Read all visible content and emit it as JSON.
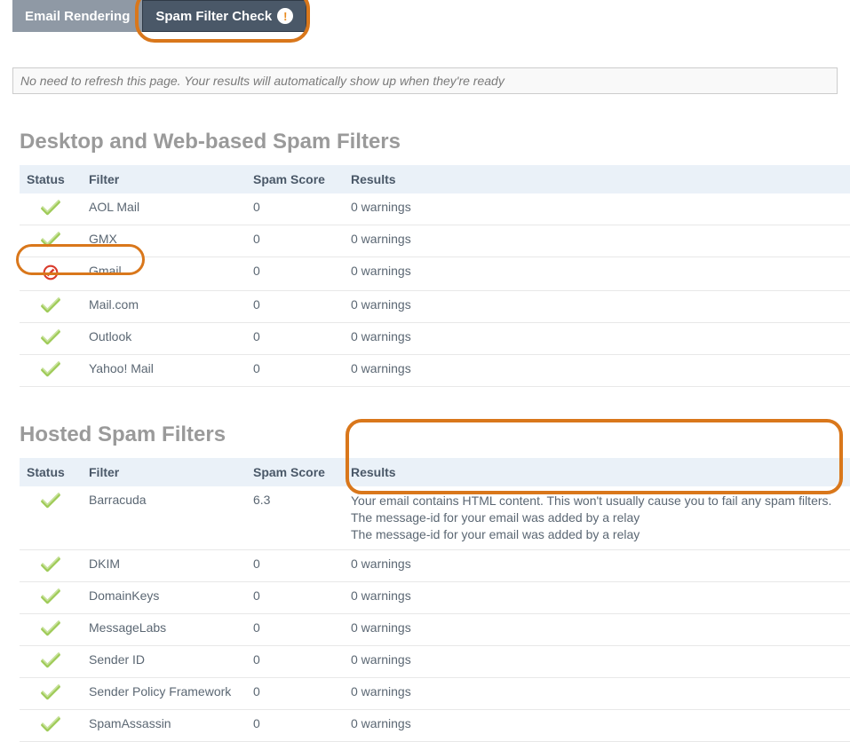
{
  "tabs": {
    "email_rendering": "Email Rendering",
    "spam_filter_check": "Spam Filter Check",
    "alert_glyph": "!"
  },
  "info_bar": "No need to refresh this page. Your results will automatically show up when they're ready",
  "sections": {
    "desktop": {
      "title": "Desktop and Web-based Spam Filters",
      "columns": {
        "status": "Status",
        "filter": "Filter",
        "score": "Spam Score",
        "results": "Results"
      },
      "rows": [
        {
          "status": "pass",
          "filter": "AOL Mail",
          "score": "0",
          "results": "0 warnings"
        },
        {
          "status": "pass",
          "filter": "GMX",
          "score": "0",
          "results": "0 warnings"
        },
        {
          "status": "fail",
          "filter": "Gmail",
          "score": "0",
          "results": "0 warnings"
        },
        {
          "status": "pass",
          "filter": "Mail.com",
          "score": "0",
          "results": "0 warnings"
        },
        {
          "status": "pass",
          "filter": "Outlook",
          "score": "0",
          "results": "0 warnings"
        },
        {
          "status": "pass",
          "filter": "Yahoo! Mail",
          "score": "0",
          "results": "0 warnings"
        }
      ]
    },
    "hosted": {
      "title": "Hosted Spam Filters",
      "columns": {
        "status": "Status",
        "filter": "Filter",
        "score": "Spam Score",
        "results": "Results"
      },
      "rows": [
        {
          "status": "pass",
          "filter": "Barracuda",
          "score": "6.3",
          "results": "Your email contains HTML content. This won't usually cause you to fail any spam filters.\nThe message-id for your email was added by a relay\nThe message-id for your email was added by a relay"
        },
        {
          "status": "pass",
          "filter": "DKIM",
          "score": "0",
          "results": "0 warnings"
        },
        {
          "status": "pass",
          "filter": "DomainKeys",
          "score": "0",
          "results": "0 warnings"
        },
        {
          "status": "pass",
          "filter": "MessageLabs",
          "score": "0",
          "results": "0 warnings"
        },
        {
          "status": "pass",
          "filter": "Sender ID",
          "score": "0",
          "results": "0 warnings"
        },
        {
          "status": "pass",
          "filter": "Sender Policy Framework",
          "score": "0",
          "results": "0 warnings"
        },
        {
          "status": "pass",
          "filter": "SpamAssassin",
          "score": "0",
          "results": "0 warnings"
        }
      ]
    }
  },
  "annotations": {
    "highlight_color": "#d9771b"
  }
}
